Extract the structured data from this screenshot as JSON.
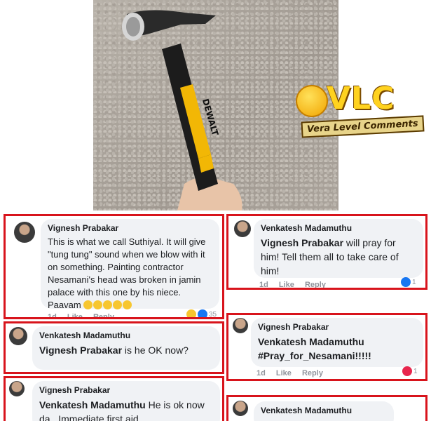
{
  "photo": {
    "tool_brand": "DEWALT",
    "logo_text": "VLC",
    "logo_tagline": "Vera Level Comments"
  },
  "comments": [
    {
      "author": "Vignesh Prabakar",
      "text": "This is what we call Suthiyal. It will give \"tung tung\" sound when we blow with it on something. Painting contractor Nesamani's head was broken in jamin palace with this one by his niece. Paavam",
      "time": "1d",
      "like": "Like",
      "reply": "Reply",
      "reaction_count": "35"
    },
    {
      "author": "Venkatesh Madamuthu",
      "mention": "Vignesh Prabakar",
      "text": "will pray for him!  Tell them all to take care of him!",
      "time": "1d",
      "like": "Like",
      "reply": "Reply",
      "reaction_count": "1"
    },
    {
      "author": "Venkatesh Madamuthu",
      "mention": "Vignesh Prabakar",
      "text": "is he OK now?"
    },
    {
      "author": "Vignesh Prabakar",
      "mention": "Venkatesh Madamuthu",
      "text": "#Pray_for_Nesamani!!!!!",
      "time": "1d",
      "like": "Like",
      "reply": "Reply",
      "reaction_count": "1"
    },
    {
      "author": "Vignesh Prabakar",
      "mention": "Venkatesh Madamuthu",
      "text": "He is ok now da.. Immediate first aid"
    },
    {
      "author": "Venkatesh Madamuthu"
    }
  ],
  "colors": {
    "frame": "#d8141c",
    "bubble": "#f0f2f5",
    "like": "#1877f2",
    "heart": "#e8264d"
  }
}
